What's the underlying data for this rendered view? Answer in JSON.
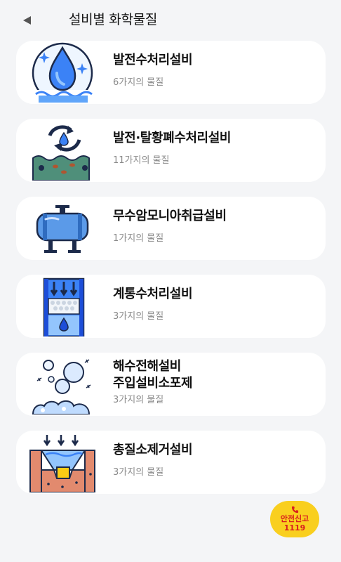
{
  "header": {
    "title": "설비별 화학물질",
    "back_icon": "back-triangle-icon"
  },
  "facilities": [
    {
      "name": "발전수처리설비",
      "count": "6가지의 물질",
      "icon": "water-drop-icon"
    },
    {
      "name": "발전·탈황폐수처리설비",
      "count": "11가지의 물질",
      "icon": "recycle-wastewater-icon"
    },
    {
      "name": "무수암모니아취급설비",
      "count": "1가지의 물질",
      "icon": "ammonia-tank-icon"
    },
    {
      "name": "계통수처리설비",
      "count": "3가지의 물질",
      "icon": "filter-column-icon"
    },
    {
      "name": "해수전해설비\n주입설비소포제",
      "count": "3가지의 물질",
      "icon": "bubbles-icon"
    },
    {
      "name": "총질소제거설비",
      "count": "3가지의 물질",
      "icon": "sediment-tank-icon"
    }
  ],
  "report_button": {
    "label": "안전신고",
    "number": "1119",
    "icon": "phone-icon",
    "color": "#f9cf1f",
    "text_color": "#d81e1e"
  }
}
